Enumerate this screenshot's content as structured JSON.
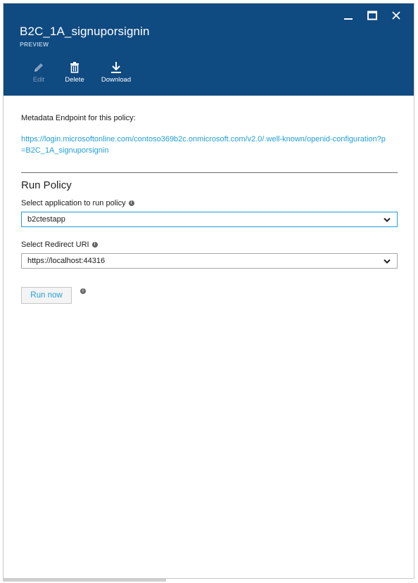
{
  "header": {
    "title": "B2C_1A_signuporsignin",
    "subtitle": "PREVIEW",
    "background_color": "#0f4a80"
  },
  "window_controls": [
    {
      "name": "minimize-icon"
    },
    {
      "name": "maximize-icon"
    },
    {
      "name": "close-icon"
    }
  ],
  "toolbar": {
    "edit_label": "Edit",
    "delete_label": "Delete",
    "download_label": "Download"
  },
  "metadata": {
    "label": "Metadata Endpoint for this policy:",
    "url": "https://login.microsoftonline.com/contoso369b2c.onmicrosoft.com/v2.0/.well-known/openid-configuration?p=B2C_1A_signuporsignin"
  },
  "run_policy": {
    "title": "Run Policy",
    "application_label": "Select application to run policy",
    "application_value": "b2ctestapp",
    "redirect_label": "Select Redirect URI",
    "redirect_value": "https://localhost:44316",
    "run_button_label": "Run now"
  },
  "colors": {
    "link": "#1f9fd6",
    "focus_border": "#1fa0d8"
  }
}
